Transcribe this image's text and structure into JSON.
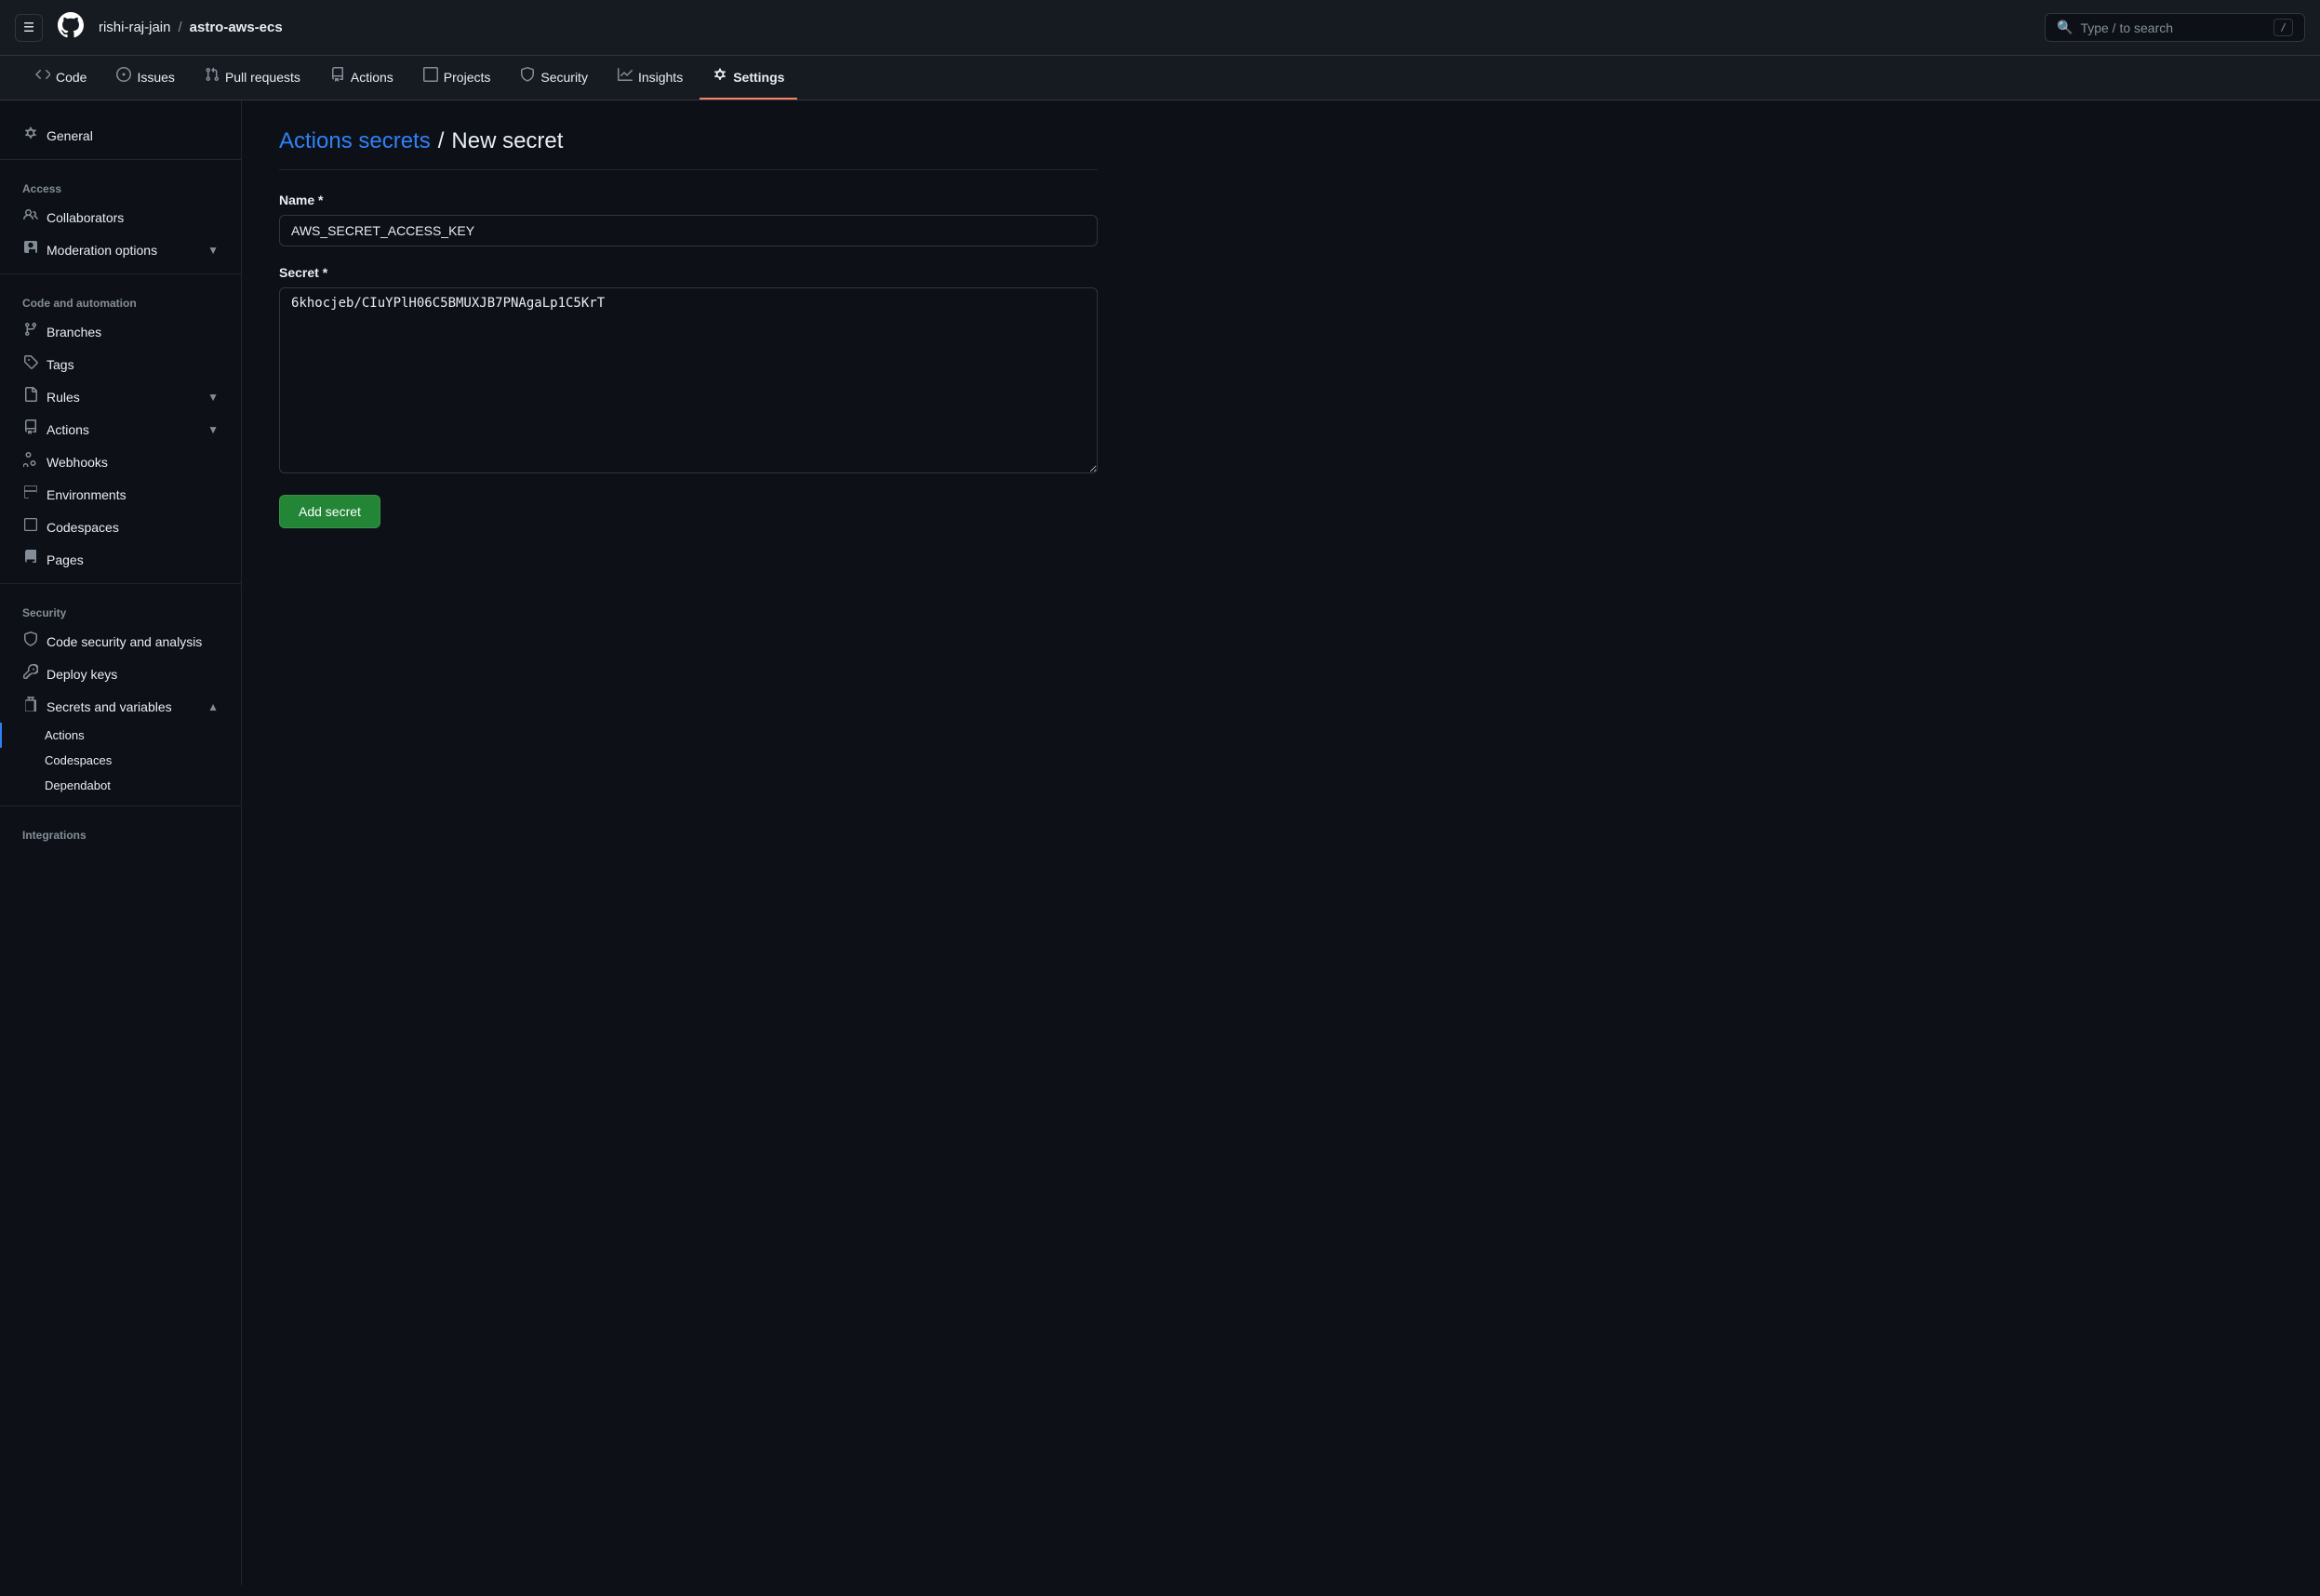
{
  "topNav": {
    "hamburger_label": "☰",
    "logo": "⬤",
    "breadcrumb": {
      "user": "rishi-raj-jain",
      "separator": "/",
      "repo": "astro-aws-ecs"
    },
    "search": {
      "placeholder": "Type / to search",
      "kbd": "/"
    }
  },
  "repoTabs": [
    {
      "id": "code",
      "icon": "⟨⟩",
      "label": "Code",
      "active": false
    },
    {
      "id": "issues",
      "icon": "◎",
      "label": "Issues",
      "active": false
    },
    {
      "id": "pulls",
      "icon": "⑃",
      "label": "Pull requests",
      "active": false
    },
    {
      "id": "actions",
      "icon": "▶",
      "label": "Actions",
      "active": false
    },
    {
      "id": "projects",
      "icon": "⊞",
      "label": "Projects",
      "active": false
    },
    {
      "id": "security",
      "icon": "⛊",
      "label": "Security",
      "active": false
    },
    {
      "id": "insights",
      "icon": "📈",
      "label": "Insights",
      "active": false
    },
    {
      "id": "settings",
      "icon": "⚙",
      "label": "Settings",
      "active": true
    }
  ],
  "sidebar": {
    "generalLabel": "General",
    "sections": [
      {
        "id": "access",
        "label": "Access",
        "items": [
          {
            "id": "collaborators",
            "icon": "👤",
            "label": "Collaborators",
            "hasChevron": false
          },
          {
            "id": "moderation",
            "icon": "💬",
            "label": "Moderation options",
            "hasChevron": true
          }
        ]
      },
      {
        "id": "code-automation",
        "label": "Code and automation",
        "items": [
          {
            "id": "branches",
            "icon": "⑂",
            "label": "Branches",
            "hasChevron": false
          },
          {
            "id": "tags",
            "icon": "◈",
            "label": "Tags",
            "hasChevron": false
          },
          {
            "id": "rules",
            "icon": "▤",
            "label": "Rules",
            "hasChevron": true
          },
          {
            "id": "actions",
            "icon": "▶",
            "label": "Actions",
            "hasChevron": true
          },
          {
            "id": "webhooks",
            "icon": "🔗",
            "label": "Webhooks",
            "hasChevron": false
          },
          {
            "id": "environments",
            "icon": "▦",
            "label": "Environments",
            "hasChevron": false
          },
          {
            "id": "codespaces",
            "icon": "▣",
            "label": "Codespaces",
            "hasChevron": false
          },
          {
            "id": "pages",
            "icon": "▢",
            "label": "Pages",
            "hasChevron": false
          }
        ]
      },
      {
        "id": "security",
        "label": "Security",
        "items": [
          {
            "id": "code-security",
            "icon": "🔍",
            "label": "Code security and analysis",
            "hasChevron": false
          },
          {
            "id": "deploy-keys",
            "icon": "🔑",
            "label": "Deploy keys",
            "hasChevron": false
          },
          {
            "id": "secrets-variables",
            "icon": "✳",
            "label": "Secrets and variables",
            "hasChevron": true,
            "expanded": true
          }
        ]
      }
    ],
    "secretsSubItems": [
      {
        "id": "actions-sub",
        "label": "Actions",
        "active": true
      },
      {
        "id": "codespaces-sub",
        "label": "Codespaces",
        "active": false
      },
      {
        "id": "dependabot-sub",
        "label": "Dependabot",
        "active": false
      }
    ],
    "integrationsLabel": "Integrations"
  },
  "mainContent": {
    "breadcrumb_link": "Actions secrets",
    "breadcrumb_sep": "/",
    "page_title": "New secret",
    "nameLabel": "Name *",
    "namePlaceholder": "",
    "nameValue": "AWS_SECRET_ACCESS_KEY",
    "secretLabel": "Secret *",
    "secretValue": "6khocjeb/CIuYPlH06C5BMUXJB7PNAgaLp1C5KrT",
    "addSecretBtn": "Add secret"
  }
}
